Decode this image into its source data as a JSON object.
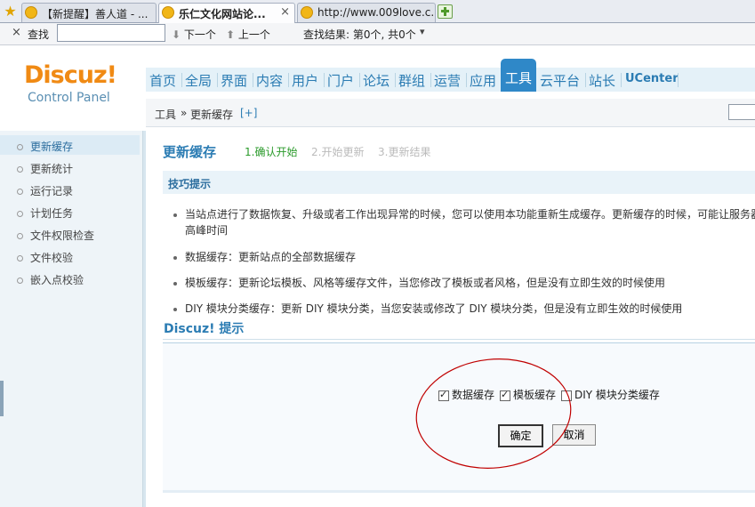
{
  "browser": {
    "tabs": [
      {
        "title": "【新提醒】善人道 - ...",
        "active": false
      },
      {
        "title": "乐仁文化网站论...",
        "active": true
      },
      {
        "title": "http://www.009love.c...",
        "active": false
      }
    ],
    "close_glyph": "×"
  },
  "findbar": {
    "close_glyph": "×",
    "label": "查找",
    "input_value": "",
    "next_label": "下一个",
    "prev_label": "上一个",
    "result_text": "查找结果: 第0个, 共0个",
    "dropdown_glyph": "▾"
  },
  "logo": {
    "brand": "Discuz!",
    "subtitle": "Control Panel"
  },
  "topnav": {
    "items": [
      "首页",
      "全局",
      "界面",
      "内容",
      "用户",
      "门户",
      "论坛",
      "群组",
      "运营",
      "应用"
    ],
    "active": "工具",
    "after": [
      "云平台",
      "站长",
      "UCenter"
    ]
  },
  "breadcrumb": {
    "section": "工具",
    "separator": "»",
    "current": "更新缓存",
    "add": "[+]"
  },
  "sidebar": {
    "items": [
      "更新缓存",
      "更新统计",
      "运行记录",
      "计划任务",
      "文件权限检查",
      "文件校验",
      "嵌入点校验"
    ],
    "active_index": 0
  },
  "page": {
    "title": "更新缓存",
    "steps": [
      "1.确认开始",
      "2.开始更新",
      "3.更新结果"
    ],
    "tips_title": "技巧提示",
    "tips": [
      "当站点进行了数据恢复、升级或者工作出现异常的时候，您可以使用本功能重新生成缓存。更新缓存的时候，可能让服务器",
      "高峰时间",
      "数据缓存：更新站点的全部数据缓存",
      "模板缓存：更新论坛模板、风格等缓存文件，当您修改了模板或者风格，但是没有立即生效的时候使用",
      "DIY 模块分类缓存：更新 DIY 模块分类，当您安装或修改了 DIY 模块分类，但是没有立即生效的时候使用"
    ],
    "notice_title": "Discuz! 提示"
  },
  "form": {
    "options": [
      {
        "label": "数据缓存",
        "checked": true
      },
      {
        "label": "模板缓存",
        "checked": true
      },
      {
        "label": "DIY 模块分类缓存",
        "checked": false
      }
    ],
    "confirm_label": "确定",
    "cancel_label": "取消"
  },
  "colors": {
    "accent": "#2f88c8",
    "logo_orange": "#f08a14",
    "annotation": "#c00000",
    "step_active": "#2a9a2a"
  }
}
